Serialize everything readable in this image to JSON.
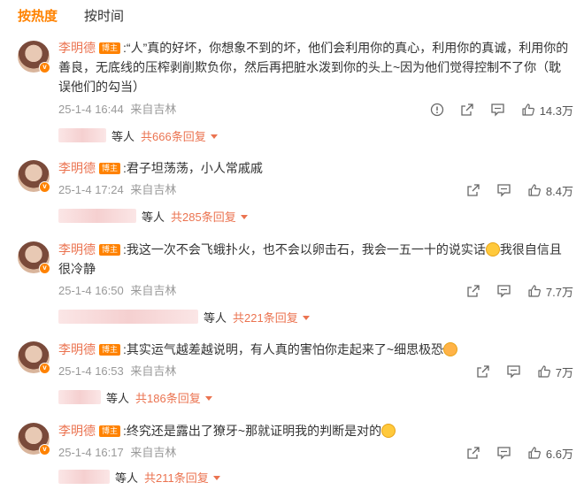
{
  "tabs": {
    "hot": "按热度",
    "time": "按时间"
  },
  "comments": [
    {
      "name": "李明德",
      "tag": "博主",
      "text": ":“人”真的好坏，你想象不到的坏，他们会利用你的真心，利用你的真诚，利用你的善良，无底线的压榨剥削欺负你，然后再把脏水泼到你的头上~因为他们觉得控制不了你（耽误他们的勾当）",
      "text_after_emoji": "",
      "date": "25-1-4 16:44",
      "source": "来自吉林",
      "likes": "14.3万",
      "replies_who": "等人",
      "replies_more": "共666条回复"
    },
    {
      "name": "李明德",
      "tag": "博主",
      "text": ":君子坦荡荡，小人常戚戚",
      "text_after_emoji": "",
      "date": "25-1-4 17:24",
      "source": "来自吉林",
      "likes": "8.4万",
      "replies_who": "等人",
      "replies_more": "共285条回复"
    },
    {
      "name": "李明德",
      "tag": "博主",
      "text": ":我这一次不会飞蛾扑火，也不会以卵击石，我会一五一十的说实话",
      "text_after_emoji": "我很自信且很冷静",
      "date": "25-1-4 16:50",
      "source": "来自吉林",
      "likes": "7.7万",
      "replies_who": "等人",
      "replies_more": "共221条回复"
    },
    {
      "name": "李明德",
      "tag": "博主",
      "text": ":其实运气越差越说明，有人真的害怕你走起来了~细思极恐",
      "text_after_emoji": "",
      "date": "25-1-4 16:53",
      "source": "来自吉林",
      "likes": "7万",
      "replies_who": "等人",
      "replies_more": "共186条回复"
    },
    {
      "name": "李明德",
      "tag": "博主",
      "text": ":终究还是露出了獠牙~那就证明我的判断是对的",
      "text_after_emoji": "",
      "date": "25-1-4 16:17",
      "source": "来自吉林",
      "likes": "6.6万",
      "replies_who": "等人",
      "replies_more": "共211条回复"
    }
  ],
  "colors": {
    "accent": "#ff8200",
    "name": "#eb7350",
    "meta": "#999999"
  },
  "icons": [
    "report-icon",
    "share-icon",
    "comment-icon",
    "like-icon"
  ]
}
